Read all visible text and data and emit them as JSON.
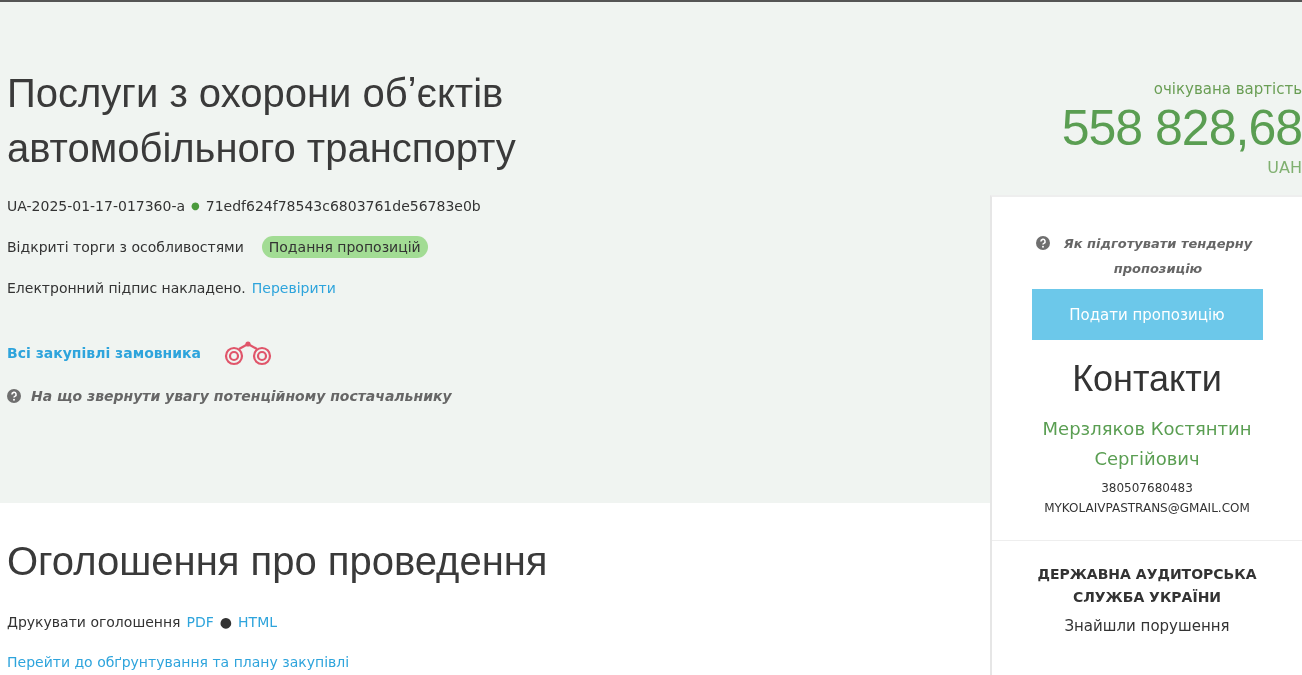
{
  "header": {
    "title": "Послуги з охорони обʼєктів автомобільного транспорту",
    "tender_id": "UA-2025-01-17-017360-a",
    "separator": "●",
    "hash": "71edf624f78543c6803761de56783e0b",
    "procedure": "Відкриті торги з особливостями",
    "status_badge": "Подання пропозицій",
    "signature_text": "Електронний підпис накладено.",
    "signature_link": "Перевірити",
    "buyer_link": "Всі закупівлі замовника",
    "hint": "На що звернути увагу потенційному постачальнику"
  },
  "price": {
    "label": "очікувана вартість",
    "amount": "558 828,68",
    "currency": "UAH"
  },
  "sidebar": {
    "hint": "Як підготувати тендерну пропозицію",
    "submit_button": "Подати пропозицію",
    "contacts_title": "Контакти",
    "contact_name": "Мерзляков Костянтин Сергійович",
    "phone": "380507680483",
    "email": "MYKOLAIVPASTRANS@GMAIL.COM",
    "audit_title": "ДЕРЖАВНА АУДИТОРСЬКА СЛУЖБА УКРАЇНИ",
    "audit_text": "Знайшли порушення"
  },
  "announcement": {
    "title": "Оголошення про проведення",
    "print_label": "Друкувати оголошення",
    "links": [
      "PDF",
      "HTML"
    ],
    "separator": "●",
    "plan_link": "Перейти до обґрунтування та плану закупівлі"
  }
}
